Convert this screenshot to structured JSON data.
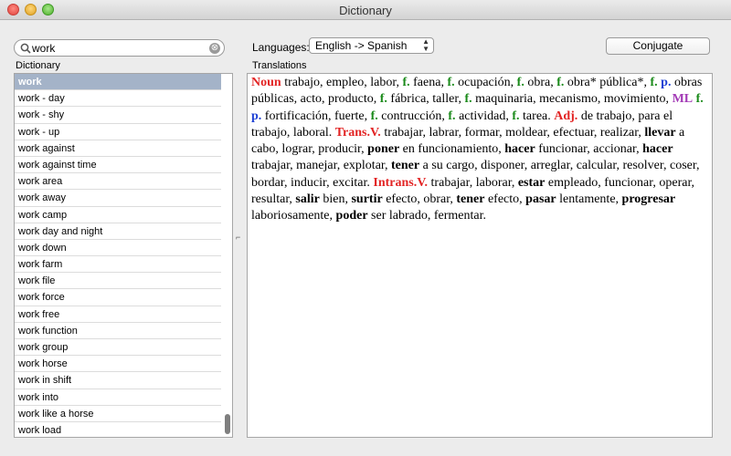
{
  "window": {
    "title": "Dictionary"
  },
  "search": {
    "value": "work",
    "clear_glyph": "⊗"
  },
  "labels": {
    "dictionary": "Dictionary",
    "translations": "Translations",
    "languages": "Languages:"
  },
  "language_select": {
    "selected": "English -> Spanish"
  },
  "buttons": {
    "conjugate": "Conjugate"
  },
  "list": {
    "items": [
      "work",
      "work - day",
      "work - shy",
      "work - up",
      "work against",
      "work against time",
      "work area",
      "work away",
      "work camp",
      "work day and night",
      "work down",
      "work farm",
      "work file",
      "work force",
      "work free",
      "work function",
      "work group",
      "work horse",
      "work in shift",
      "work into",
      "work like a horse",
      "work load"
    ],
    "selected_index": 0
  },
  "translation_segments": [
    {
      "t": "Noun",
      "c": "pos"
    },
    {
      "t": " trabajo, empleo, labor, "
    },
    {
      "t": "f.",
      "c": "g-f"
    },
    {
      "t": " faena, "
    },
    {
      "t": "f.",
      "c": "g-f"
    },
    {
      "t": " ocupación, "
    },
    {
      "t": "f.",
      "c": "g-f"
    },
    {
      "t": " obra, "
    },
    {
      "t": "f.",
      "c": "g-f"
    },
    {
      "t": " obra* pública*, "
    },
    {
      "t": "f.",
      "c": "g-f"
    },
    {
      "t": " "
    },
    {
      "t": "p.",
      "c": "g-p"
    },
    {
      "t": " obras públicas, acto, producto, "
    },
    {
      "t": "f.",
      "c": "g-f"
    },
    {
      "t": " fábrica, taller, "
    },
    {
      "t": "f.",
      "c": "g-f"
    },
    {
      "t": " maquinaria, mecanismo, movimiento, "
    },
    {
      "t": "ML",
      "c": "g-ml"
    },
    {
      "t": " "
    },
    {
      "t": "f.",
      "c": "g-f"
    },
    {
      "t": " "
    },
    {
      "t": "p.",
      "c": "g-p"
    },
    {
      "t": " fortificación, fuerte, "
    },
    {
      "t": "f.",
      "c": "g-f"
    },
    {
      "t": " contrucción, "
    },
    {
      "t": "f.",
      "c": "g-f"
    },
    {
      "t": " actividad, "
    },
    {
      "t": "f.",
      "c": "g-f"
    },
    {
      "t": " tarea. "
    },
    {
      "t": "Adj.",
      "c": "pos"
    },
    {
      "t": " de trabajo, para el trabajo, laboral. "
    },
    {
      "t": "Trans.V.",
      "c": "pos"
    },
    {
      "t": " trabajar, labrar, formar, moldear, efectuar, realizar, "
    },
    {
      "t": "llevar",
      "c": "b"
    },
    {
      "t": " a cabo, lograr, producir, "
    },
    {
      "t": "poner",
      "c": "b"
    },
    {
      "t": " en funcionamiento, "
    },
    {
      "t": "hacer",
      "c": "b"
    },
    {
      "t": " funcionar, accionar, "
    },
    {
      "t": "hacer",
      "c": "b"
    },
    {
      "t": " trabajar, manejar, explotar, "
    },
    {
      "t": "tener",
      "c": "b"
    },
    {
      "t": " a su cargo, disponer, arreglar, calcular, resolver, coser, bordar, inducir, excitar. "
    },
    {
      "t": "Intrans.V.",
      "c": "pos"
    },
    {
      "t": " trabajar, laborar, "
    },
    {
      "t": "estar",
      "c": "b"
    },
    {
      "t": " empleado, funcionar, operar, resultar, "
    },
    {
      "t": "salir",
      "c": "b"
    },
    {
      "t": " bien, "
    },
    {
      "t": "surtir",
      "c": "b"
    },
    {
      "t": " efecto, obrar, "
    },
    {
      "t": "tener",
      "c": "b"
    },
    {
      "t": " efecto, "
    },
    {
      "t": "pasar",
      "c": "b"
    },
    {
      "t": " lentamente, "
    },
    {
      "t": "progresar",
      "c": "b"
    },
    {
      "t": " laboriosamente, "
    },
    {
      "t": "poder",
      "c": "b"
    },
    {
      "t": " ser labrado, fermentar."
    }
  ],
  "colors": {
    "part_of_speech": "#e22424",
    "gender_f": "#1a8a1a",
    "plural_p": "#1c3fd4",
    "ml": "#a33bb6",
    "selection": "#a4b3c8"
  }
}
